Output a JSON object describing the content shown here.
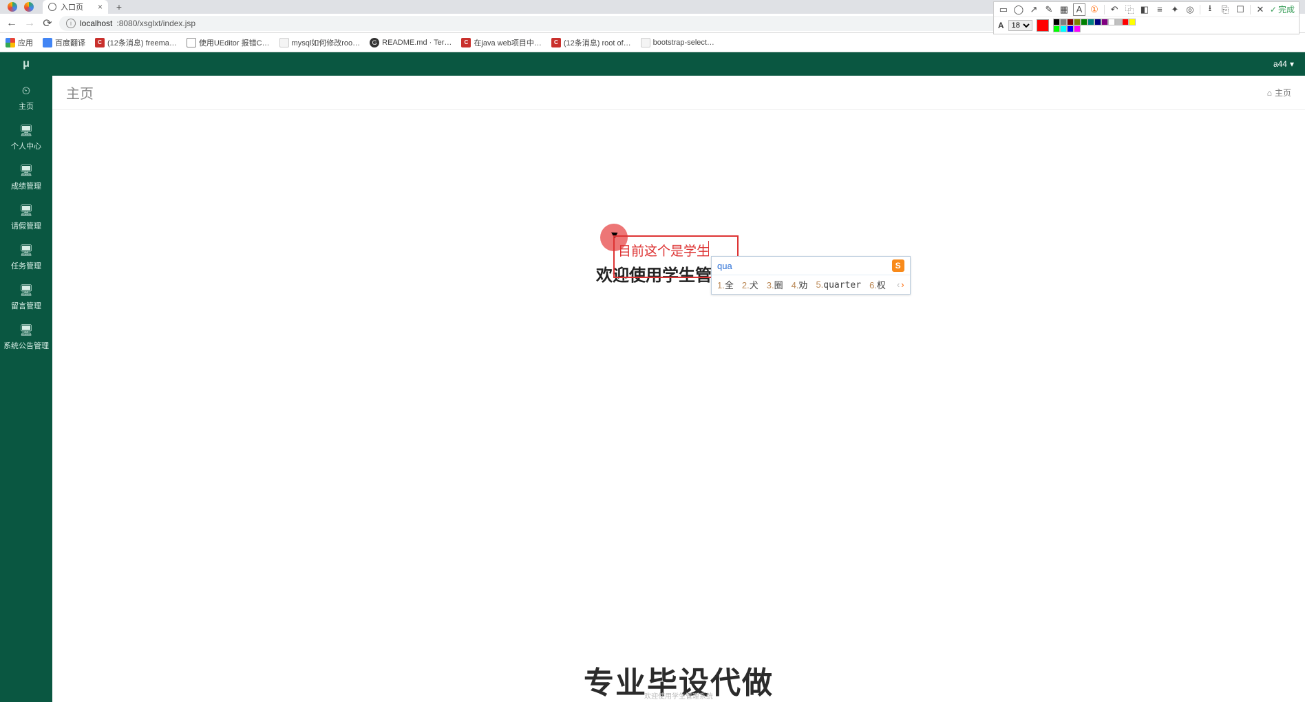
{
  "browser": {
    "tab_title": "入口页",
    "url_host": "localhost",
    "url_port_path": ":8080/xsglxt/index.jsp"
  },
  "bookmarks": {
    "apps": "应用",
    "items": [
      "百度翻译",
      "(12条消息) freema…",
      "使用UEditor 报错C…",
      "mysql如何修改roo…",
      "README.md · Ter…",
      "在java web项目中…",
      "(12条消息) root of…",
      "bootstrap-select…"
    ]
  },
  "snip": {
    "done": "完成",
    "font_label": "A",
    "font_size": "18",
    "selected_color": "#ff0000",
    "palette": [
      "#000000",
      "#808080",
      "#800000",
      "#808000",
      "#008000",
      "#008080",
      "#000080",
      "#800080",
      "#ffffff",
      "#c0c0c0",
      "#ff0000",
      "#ffff00",
      "#00ff00",
      "#00ffff",
      "#0000ff",
      "#ff00ff"
    ]
  },
  "app": {
    "logo": "μ",
    "user": "a44"
  },
  "sidebar": {
    "items": [
      {
        "icon": "⏱",
        "label": "主页"
      },
      {
        "icon": "🖥",
        "label": "个人中心"
      },
      {
        "icon": "🖥",
        "label": "成绩管理"
      },
      {
        "icon": "🖥",
        "label": "请假管理"
      },
      {
        "icon": "🖥",
        "label": "任务管理"
      },
      {
        "icon": "🖥",
        "label": "留言管理"
      },
      {
        "icon": "🖥",
        "label": "系统公告管理"
      }
    ]
  },
  "page": {
    "title": "主页",
    "crumb": "主页",
    "welcome": "欢迎使用学生管理系统"
  },
  "watermark": {
    "big": "专业毕设代做",
    "small": "欢迎使用学生管理系统"
  },
  "annotation": {
    "text": "目前这个是学生"
  },
  "ime": {
    "input": "qua",
    "candidates": [
      {
        "n": "1.",
        "c": "全"
      },
      {
        "n": "2.",
        "c": "犬"
      },
      {
        "n": "3.",
        "c": "圈"
      },
      {
        "n": "4.",
        "c": "劝"
      },
      {
        "n": "5.",
        "c": "quarter"
      },
      {
        "n": "6.",
        "c": "权"
      }
    ]
  }
}
